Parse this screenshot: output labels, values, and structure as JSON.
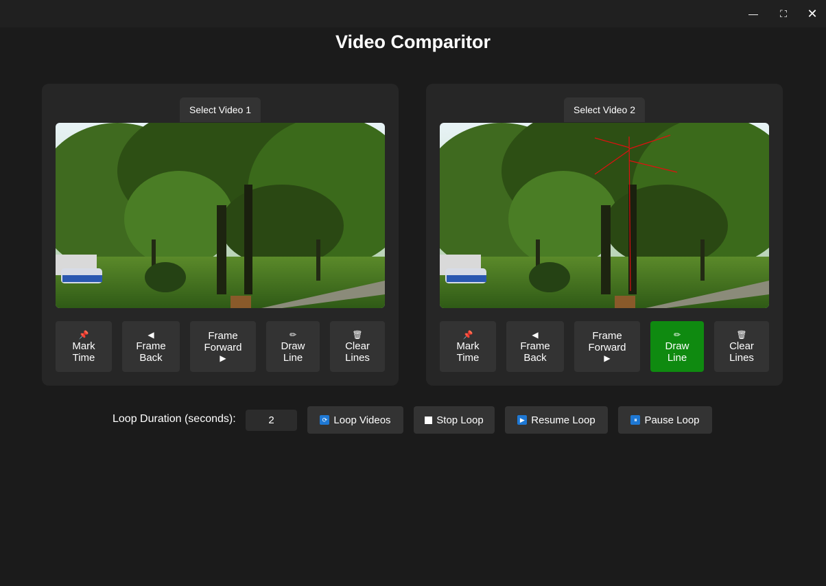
{
  "window": {
    "minimize_icon": "minimize-icon",
    "maximize_icon": "maximize-icon",
    "close_icon": "close-icon",
    "minimize_glyph": "—",
    "maximize_glyph": "⛶",
    "close_glyph": "✕"
  },
  "app": {
    "title": "Video Comparitor"
  },
  "colors": {
    "background": "#1b1b1b",
    "panel": "#262626",
    "button": "#333333",
    "active": "#0f8a10",
    "accent_blue": "#1e78d4",
    "annotation": "#e01010"
  },
  "video1": {
    "select_label": "Select Video 1",
    "controls": {
      "mark_icon": "📌",
      "mark_line1": "Mark",
      "mark_line2": "Time",
      "back_icon": "◀",
      "back_line1": "Frame",
      "back_line2": "Back",
      "fwd_line1": "Frame",
      "fwd_line2": "Forward",
      "fwd_icon": "▶",
      "draw_icon": "✏",
      "draw_line1": "Draw",
      "draw_line2": "Line",
      "clear_icon": "🗑",
      "clear_line1": "Clear",
      "clear_line2": "Lines"
    },
    "draw_active": false
  },
  "video2": {
    "select_label": "Select Video 2",
    "controls": {
      "mark_icon": "📌",
      "mark_line1": "Mark",
      "mark_line2": "Time",
      "back_icon": "◀",
      "back_line1": "Frame",
      "back_line2": "Back",
      "fwd_line1": "Frame",
      "fwd_line2": "Forward",
      "fwd_icon": "▶",
      "draw_icon": "✏",
      "draw_line1": "Draw",
      "draw_line2": "Line",
      "clear_icon": "🗑",
      "clear_line1": "Clear",
      "clear_line2": "Lines"
    },
    "draw_active": true
  },
  "loop": {
    "duration_label": "Loop Duration (seconds):",
    "duration_value": "2",
    "loop_label": "Loop Videos",
    "loop_icon": "⟳",
    "stop_label": "Stop Loop",
    "resume_label": "Resume Loop",
    "resume_icon": "▶",
    "pause_label": "Pause Loop",
    "pause_icon": "⏸"
  }
}
